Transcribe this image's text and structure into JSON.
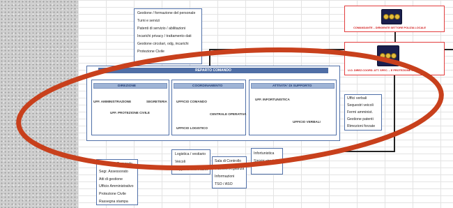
{
  "top_list": [
    "Gestione / formazione del personale",
    "Turni e servizi",
    "",
    "Patenti di servizio / abilitazioni",
    "Incarichi privacy / trattamento dati",
    "Gestione circolari, odg, incarichi",
    "Protezione Civile"
  ],
  "command_banners": [
    "COMANDANTE – DIRIGENTE SETTORE POLIZIA LOCALE",
    "U.O. DIREZ.COORD. ATT. SPEC. – E PROTEZIONE CIVILE"
  ],
  "reparto": {
    "title": "REPARTO COMANDO",
    "sections": [
      {
        "header": "DIREZIONE",
        "items": [
          "UFF. AMMINISTRAZIONE",
          "SEGRETERIA",
          "UFF. PROTEZIONE CIVILE"
        ]
      },
      {
        "header": "COORDINAMENTO",
        "items": [
          "UFFICIO COMANDO",
          "CENTRALE OPERATIVA",
          "UFFICIO LOGISTICO"
        ]
      },
      {
        "header": "ATTIVITA' DI SUPPORTO",
        "items": [
          "UFF. INFORTUNISTICA",
          "UFFICIO VERBALI"
        ]
      }
    ]
  },
  "right_list": [
    "Uffici verbali",
    "Sequestri veicoli",
    "Fermi amminist.",
    "Gestione patenti",
    "Rimozioni forzate"
  ],
  "bottom_left_list": [
    "Segreteria Comando",
    "Segr. Assessorato",
    "Atti di gestione",
    "Ufficio Amministrativo",
    "Protezione Civile",
    "Rassegna stampa"
  ],
  "logistica_list": [
    "Logistica / vestiario",
    "Veicoli",
    "Supporto informatico"
  ],
  "centrale_list": [
    "Sala di Controllo",
    "Videosorveglianza",
    "Informazioni",
    "TSO / ASO"
  ],
  "infortunistica_list": [
    "Infortunistica",
    "",
    "Sinistri stradali"
  ],
  "colors": {
    "annotation_ellipse": "#c8401c",
    "box_border": "#4f6fa8",
    "command_border": "#e23d3d",
    "header_band": "#4f6ea6"
  }
}
